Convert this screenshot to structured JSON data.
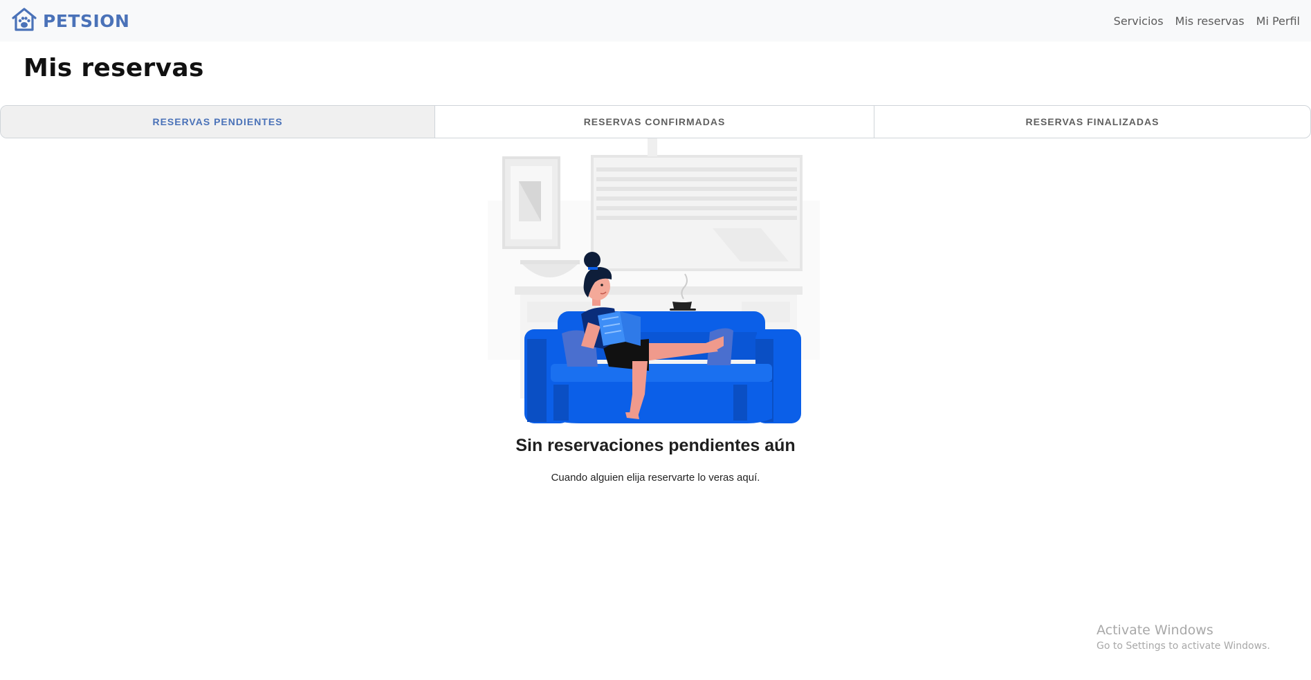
{
  "navbar": {
    "brand": "PETSION",
    "links": [
      {
        "label": "Servicios"
      },
      {
        "label": "Mis reservas"
      },
      {
        "label": "Mi Perfil"
      }
    ]
  },
  "page": {
    "title": "Mis reservas"
  },
  "tabs": [
    {
      "label": "RESERVAS PENDIENTES",
      "active": true
    },
    {
      "label": "RESERVAS CONFIRMADAS",
      "active": false
    },
    {
      "label": "RESERVAS FINALIZADAS",
      "active": false
    }
  ],
  "empty_state": {
    "title": "Sin reservaciones pendientes aún",
    "subtitle": "Cuando alguien elija reservarte lo veras aquí."
  },
  "watermark": {
    "title": "Activate Windows",
    "subtitle": "Go to Settings to activate Windows."
  },
  "colors": {
    "brand": "#4a72b8",
    "sofa": "#0b5fe8",
    "navbar_bg": "#f8f9fa"
  },
  "icons": {
    "brand_icon": "house-paw-icon"
  }
}
